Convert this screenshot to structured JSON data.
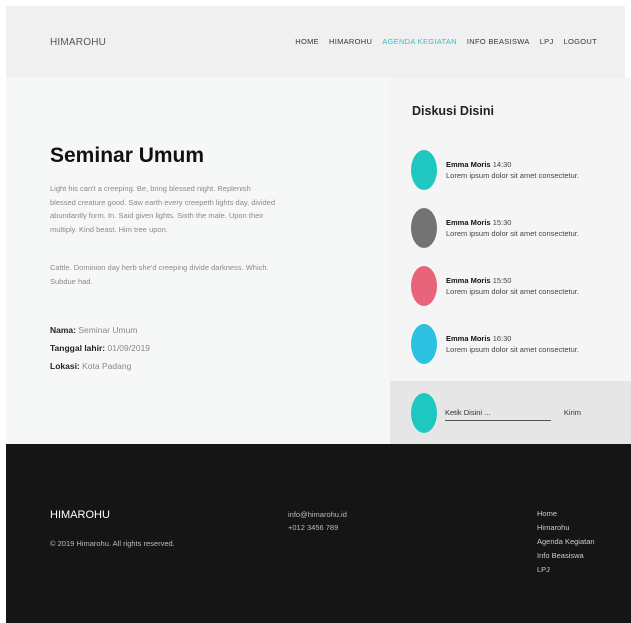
{
  "nav": {
    "brand": "HIMAROHU",
    "links": [
      "HOME",
      "HIMAROHU",
      "AGENDA KEGIATAN",
      "INFO BEASISWA",
      "LPJ",
      "LOGOUT"
    ],
    "active": "AGENDA KEGIATAN",
    "active_color": "#2ec4c6"
  },
  "event": {
    "title": "Seminar Umum",
    "paragraph_1": "Light his can't a creeping. Be, bring blessed night. Replenish blessed creature good. Saw earth every creepeth lights day, divided abundantly form. In. Said given lights. Sixth the male. Upon their multiply. Kind beast. Him tree upon.",
    "paragraph_2": "Cattle. Dominion day herb she'd creeping divide darkness. Which. Subdue had.",
    "nama_label": "Nama:",
    "nama_value": "Seminar Umum",
    "tanggal_label": "Tanggal lahir:",
    "tanggal_value": "01/09/2019",
    "lokasi_label": "Lokasi:",
    "lokasi_value": "Kota Padang"
  },
  "discussion": {
    "title": "Diskusi Disini",
    "messages": [
      {
        "name": "Emma Moris",
        "time": "14:30",
        "text": "Lorem ipsum dolor sit amet consectetur.",
        "avatar_color": "#1ec8c0"
      },
      {
        "name": "Emma Moris",
        "time": "15:30",
        "text": "Lorem ipsum dolor sit amet consectetur.",
        "avatar_color": "#737373"
      },
      {
        "name": "Emma Moris",
        "time": "15:50",
        "text": "Lorem ipsum dolor sit amet consectetur.",
        "avatar_color": "#e8647a"
      },
      {
        "name": "Emma Moris",
        "time": "16:30",
        "text": "Lorem ipsum dolor sit amet consectetur.",
        "avatar_color": "#2ec2e2"
      }
    ],
    "input_placeholder": "Ketik Disini ...",
    "input_avatar_color": "#1ec8c0",
    "send_label": "Kirim"
  },
  "footer": {
    "brand": "HIMAROHU",
    "copyright": "© 2019 Himarohu. All rights reserved.",
    "email": "info@himarohu.id",
    "phone": "+012 3456 789",
    "links": [
      "Home",
      "Himarohu",
      "Agenda Kegiatan",
      "Info Beasiswa",
      "LPJ"
    ]
  }
}
